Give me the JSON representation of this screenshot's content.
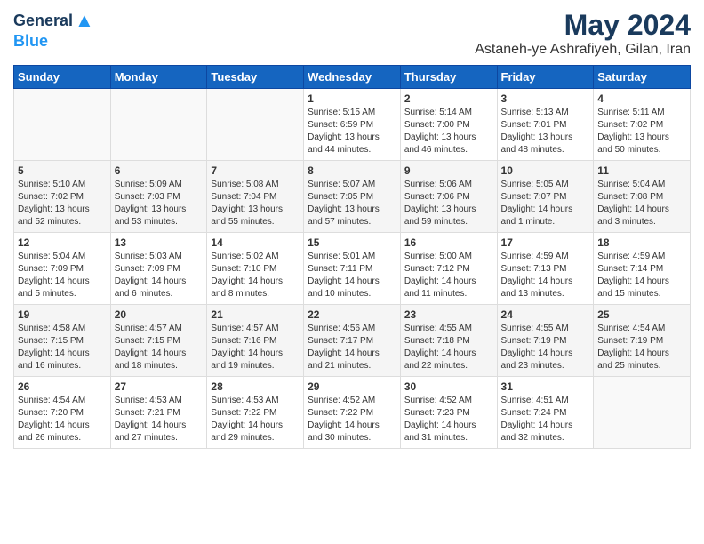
{
  "header": {
    "logo_general": "General",
    "logo_blue": "Blue",
    "month_year": "May 2024",
    "location": "Astaneh-ye Ashrafiyeh, Gilan, Iran"
  },
  "days_of_week": [
    "Sunday",
    "Monday",
    "Tuesday",
    "Wednesday",
    "Thursday",
    "Friday",
    "Saturday"
  ],
  "weeks": [
    [
      {
        "day": "",
        "info": ""
      },
      {
        "day": "",
        "info": ""
      },
      {
        "day": "",
        "info": ""
      },
      {
        "day": "1",
        "info": "Sunrise: 5:15 AM\nSunset: 6:59 PM\nDaylight: 13 hours\nand 44 minutes."
      },
      {
        "day": "2",
        "info": "Sunrise: 5:14 AM\nSunset: 7:00 PM\nDaylight: 13 hours\nand 46 minutes."
      },
      {
        "day": "3",
        "info": "Sunrise: 5:13 AM\nSunset: 7:01 PM\nDaylight: 13 hours\nand 48 minutes."
      },
      {
        "day": "4",
        "info": "Sunrise: 5:11 AM\nSunset: 7:02 PM\nDaylight: 13 hours\nand 50 minutes."
      }
    ],
    [
      {
        "day": "5",
        "info": "Sunrise: 5:10 AM\nSunset: 7:02 PM\nDaylight: 13 hours\nand 52 minutes."
      },
      {
        "day": "6",
        "info": "Sunrise: 5:09 AM\nSunset: 7:03 PM\nDaylight: 13 hours\nand 53 minutes."
      },
      {
        "day": "7",
        "info": "Sunrise: 5:08 AM\nSunset: 7:04 PM\nDaylight: 13 hours\nand 55 minutes."
      },
      {
        "day": "8",
        "info": "Sunrise: 5:07 AM\nSunset: 7:05 PM\nDaylight: 13 hours\nand 57 minutes."
      },
      {
        "day": "9",
        "info": "Sunrise: 5:06 AM\nSunset: 7:06 PM\nDaylight: 13 hours\nand 59 minutes."
      },
      {
        "day": "10",
        "info": "Sunrise: 5:05 AM\nSunset: 7:07 PM\nDaylight: 14 hours\nand 1 minute."
      },
      {
        "day": "11",
        "info": "Sunrise: 5:04 AM\nSunset: 7:08 PM\nDaylight: 14 hours\nand 3 minutes."
      }
    ],
    [
      {
        "day": "12",
        "info": "Sunrise: 5:04 AM\nSunset: 7:09 PM\nDaylight: 14 hours\nand 5 minutes."
      },
      {
        "day": "13",
        "info": "Sunrise: 5:03 AM\nSunset: 7:09 PM\nDaylight: 14 hours\nand 6 minutes."
      },
      {
        "day": "14",
        "info": "Sunrise: 5:02 AM\nSunset: 7:10 PM\nDaylight: 14 hours\nand 8 minutes."
      },
      {
        "day": "15",
        "info": "Sunrise: 5:01 AM\nSunset: 7:11 PM\nDaylight: 14 hours\nand 10 minutes."
      },
      {
        "day": "16",
        "info": "Sunrise: 5:00 AM\nSunset: 7:12 PM\nDaylight: 14 hours\nand 11 minutes."
      },
      {
        "day": "17",
        "info": "Sunrise: 4:59 AM\nSunset: 7:13 PM\nDaylight: 14 hours\nand 13 minutes."
      },
      {
        "day": "18",
        "info": "Sunrise: 4:59 AM\nSunset: 7:14 PM\nDaylight: 14 hours\nand 15 minutes."
      }
    ],
    [
      {
        "day": "19",
        "info": "Sunrise: 4:58 AM\nSunset: 7:15 PM\nDaylight: 14 hours\nand 16 minutes."
      },
      {
        "day": "20",
        "info": "Sunrise: 4:57 AM\nSunset: 7:15 PM\nDaylight: 14 hours\nand 18 minutes."
      },
      {
        "day": "21",
        "info": "Sunrise: 4:57 AM\nSunset: 7:16 PM\nDaylight: 14 hours\nand 19 minutes."
      },
      {
        "day": "22",
        "info": "Sunrise: 4:56 AM\nSunset: 7:17 PM\nDaylight: 14 hours\nand 21 minutes."
      },
      {
        "day": "23",
        "info": "Sunrise: 4:55 AM\nSunset: 7:18 PM\nDaylight: 14 hours\nand 22 minutes."
      },
      {
        "day": "24",
        "info": "Sunrise: 4:55 AM\nSunset: 7:19 PM\nDaylight: 14 hours\nand 23 minutes."
      },
      {
        "day": "25",
        "info": "Sunrise: 4:54 AM\nSunset: 7:19 PM\nDaylight: 14 hours\nand 25 minutes."
      }
    ],
    [
      {
        "day": "26",
        "info": "Sunrise: 4:54 AM\nSunset: 7:20 PM\nDaylight: 14 hours\nand 26 minutes."
      },
      {
        "day": "27",
        "info": "Sunrise: 4:53 AM\nSunset: 7:21 PM\nDaylight: 14 hours\nand 27 minutes."
      },
      {
        "day": "28",
        "info": "Sunrise: 4:53 AM\nSunset: 7:22 PM\nDaylight: 14 hours\nand 29 minutes."
      },
      {
        "day": "29",
        "info": "Sunrise: 4:52 AM\nSunset: 7:22 PM\nDaylight: 14 hours\nand 30 minutes."
      },
      {
        "day": "30",
        "info": "Sunrise: 4:52 AM\nSunset: 7:23 PM\nDaylight: 14 hours\nand 31 minutes."
      },
      {
        "day": "31",
        "info": "Sunrise: 4:51 AM\nSunset: 7:24 PM\nDaylight: 14 hours\nand 32 minutes."
      },
      {
        "day": "",
        "info": ""
      }
    ]
  ]
}
